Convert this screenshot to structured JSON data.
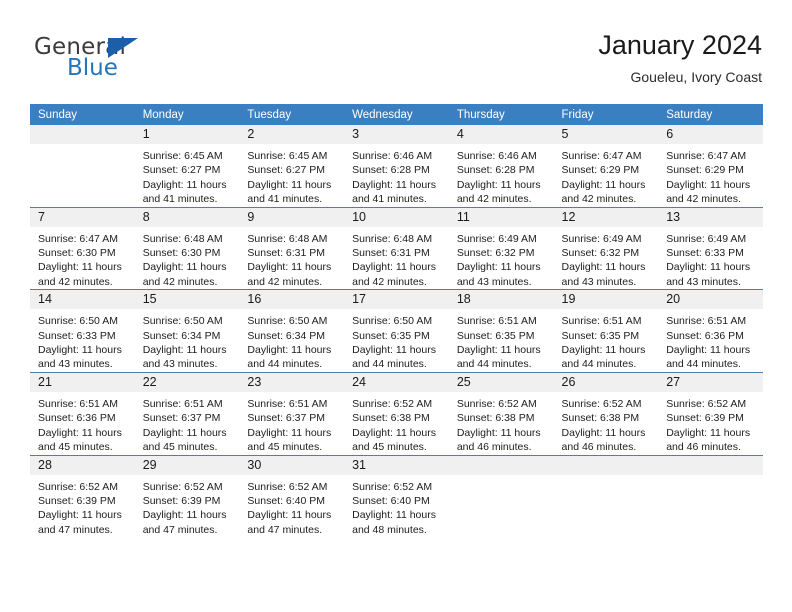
{
  "brand": {
    "word_one": "General",
    "word_two": "Blue",
    "triangle_color": "#1c5fa8",
    "blue_color": "#2376bc"
  },
  "header": {
    "title": "January 2024",
    "subtitle": "Goueleu, Ivory Coast"
  },
  "theme": {
    "header_blue": "#3a7fc1",
    "daynum_gray": "#f0f0f0",
    "row_separator": "#4a7fb5"
  },
  "weekday_headers": [
    "Sunday",
    "Monday",
    "Tuesday",
    "Wednesday",
    "Thursday",
    "Friday",
    "Saturday"
  ],
  "labels": {
    "sunrise_prefix": "Sunrise: ",
    "sunset_prefix": "Sunset: ",
    "daylight_prefix": "Daylight: "
  },
  "weeks": [
    [
      {
        "day": "",
        "blank": true
      },
      {
        "day": "1",
        "sunrise": "Sunrise: 6:45 AM",
        "sunset": "Sunset: 6:27 PM",
        "daylight1": "Daylight: 11 hours",
        "daylight2": "and 41 minutes."
      },
      {
        "day": "2",
        "sunrise": "Sunrise: 6:45 AM",
        "sunset": "Sunset: 6:27 PM",
        "daylight1": "Daylight: 11 hours",
        "daylight2": "and 41 minutes."
      },
      {
        "day": "3",
        "sunrise": "Sunrise: 6:46 AM",
        "sunset": "Sunset: 6:28 PM",
        "daylight1": "Daylight: 11 hours",
        "daylight2": "and 41 minutes."
      },
      {
        "day": "4",
        "sunrise": "Sunrise: 6:46 AM",
        "sunset": "Sunset: 6:28 PM",
        "daylight1": "Daylight: 11 hours",
        "daylight2": "and 42 minutes."
      },
      {
        "day": "5",
        "sunrise": "Sunrise: 6:47 AM",
        "sunset": "Sunset: 6:29 PM",
        "daylight1": "Daylight: 11 hours",
        "daylight2": "and 42 minutes."
      },
      {
        "day": "6",
        "sunrise": "Sunrise: 6:47 AM",
        "sunset": "Sunset: 6:29 PM",
        "daylight1": "Daylight: 11 hours",
        "daylight2": "and 42 minutes."
      }
    ],
    [
      {
        "day": "7",
        "sunrise": "Sunrise: 6:47 AM",
        "sunset": "Sunset: 6:30 PM",
        "daylight1": "Daylight: 11 hours",
        "daylight2": "and 42 minutes."
      },
      {
        "day": "8",
        "sunrise": "Sunrise: 6:48 AM",
        "sunset": "Sunset: 6:30 PM",
        "daylight1": "Daylight: 11 hours",
        "daylight2": "and 42 minutes."
      },
      {
        "day": "9",
        "sunrise": "Sunrise: 6:48 AM",
        "sunset": "Sunset: 6:31 PM",
        "daylight1": "Daylight: 11 hours",
        "daylight2": "and 42 minutes."
      },
      {
        "day": "10",
        "sunrise": "Sunrise: 6:48 AM",
        "sunset": "Sunset: 6:31 PM",
        "daylight1": "Daylight: 11 hours",
        "daylight2": "and 42 minutes."
      },
      {
        "day": "11",
        "sunrise": "Sunrise: 6:49 AM",
        "sunset": "Sunset: 6:32 PM",
        "daylight1": "Daylight: 11 hours",
        "daylight2": "and 43 minutes."
      },
      {
        "day": "12",
        "sunrise": "Sunrise: 6:49 AM",
        "sunset": "Sunset: 6:32 PM",
        "daylight1": "Daylight: 11 hours",
        "daylight2": "and 43 minutes."
      },
      {
        "day": "13",
        "sunrise": "Sunrise: 6:49 AM",
        "sunset": "Sunset: 6:33 PM",
        "daylight1": "Daylight: 11 hours",
        "daylight2": "and 43 minutes."
      }
    ],
    [
      {
        "day": "14",
        "sunrise": "Sunrise: 6:50 AM",
        "sunset": "Sunset: 6:33 PM",
        "daylight1": "Daylight: 11 hours",
        "daylight2": "and 43 minutes."
      },
      {
        "day": "15",
        "sunrise": "Sunrise: 6:50 AM",
        "sunset": "Sunset: 6:34 PM",
        "daylight1": "Daylight: 11 hours",
        "daylight2": "and 43 minutes."
      },
      {
        "day": "16",
        "sunrise": "Sunrise: 6:50 AM",
        "sunset": "Sunset: 6:34 PM",
        "daylight1": "Daylight: 11 hours",
        "daylight2": "and 44 minutes."
      },
      {
        "day": "17",
        "sunrise": "Sunrise: 6:50 AM",
        "sunset": "Sunset: 6:35 PM",
        "daylight1": "Daylight: 11 hours",
        "daylight2": "and 44 minutes."
      },
      {
        "day": "18",
        "sunrise": "Sunrise: 6:51 AM",
        "sunset": "Sunset: 6:35 PM",
        "daylight1": "Daylight: 11 hours",
        "daylight2": "and 44 minutes."
      },
      {
        "day": "19",
        "sunrise": "Sunrise: 6:51 AM",
        "sunset": "Sunset: 6:35 PM",
        "daylight1": "Daylight: 11 hours",
        "daylight2": "and 44 minutes."
      },
      {
        "day": "20",
        "sunrise": "Sunrise: 6:51 AM",
        "sunset": "Sunset: 6:36 PM",
        "daylight1": "Daylight: 11 hours",
        "daylight2": "and 44 minutes."
      }
    ],
    [
      {
        "day": "21",
        "sunrise": "Sunrise: 6:51 AM",
        "sunset": "Sunset: 6:36 PM",
        "daylight1": "Daylight: 11 hours",
        "daylight2": "and 45 minutes."
      },
      {
        "day": "22",
        "sunrise": "Sunrise: 6:51 AM",
        "sunset": "Sunset: 6:37 PM",
        "daylight1": "Daylight: 11 hours",
        "daylight2": "and 45 minutes."
      },
      {
        "day": "23",
        "sunrise": "Sunrise: 6:51 AM",
        "sunset": "Sunset: 6:37 PM",
        "daylight1": "Daylight: 11 hours",
        "daylight2": "and 45 minutes."
      },
      {
        "day": "24",
        "sunrise": "Sunrise: 6:52 AM",
        "sunset": "Sunset: 6:38 PM",
        "daylight1": "Daylight: 11 hours",
        "daylight2": "and 45 minutes."
      },
      {
        "day": "25",
        "sunrise": "Sunrise: 6:52 AM",
        "sunset": "Sunset: 6:38 PM",
        "daylight1": "Daylight: 11 hours",
        "daylight2": "and 46 minutes."
      },
      {
        "day": "26",
        "sunrise": "Sunrise: 6:52 AM",
        "sunset": "Sunset: 6:38 PM",
        "daylight1": "Daylight: 11 hours",
        "daylight2": "and 46 minutes."
      },
      {
        "day": "27",
        "sunrise": "Sunrise: 6:52 AM",
        "sunset": "Sunset: 6:39 PM",
        "daylight1": "Daylight: 11 hours",
        "daylight2": "and 46 minutes."
      }
    ],
    [
      {
        "day": "28",
        "sunrise": "Sunrise: 6:52 AM",
        "sunset": "Sunset: 6:39 PM",
        "daylight1": "Daylight: 11 hours",
        "daylight2": "and 47 minutes."
      },
      {
        "day": "29",
        "sunrise": "Sunrise: 6:52 AM",
        "sunset": "Sunset: 6:39 PM",
        "daylight1": "Daylight: 11 hours",
        "daylight2": "and 47 minutes."
      },
      {
        "day": "30",
        "sunrise": "Sunrise: 6:52 AM",
        "sunset": "Sunset: 6:40 PM",
        "daylight1": "Daylight: 11 hours",
        "daylight2": "and 47 minutes."
      },
      {
        "day": "31",
        "sunrise": "Sunrise: 6:52 AM",
        "sunset": "Sunset: 6:40 PM",
        "daylight1": "Daylight: 11 hours",
        "daylight2": "and 48 minutes."
      },
      {
        "day": "",
        "blank": true
      },
      {
        "day": "",
        "blank": true
      },
      {
        "day": "",
        "blank": true
      }
    ]
  ]
}
